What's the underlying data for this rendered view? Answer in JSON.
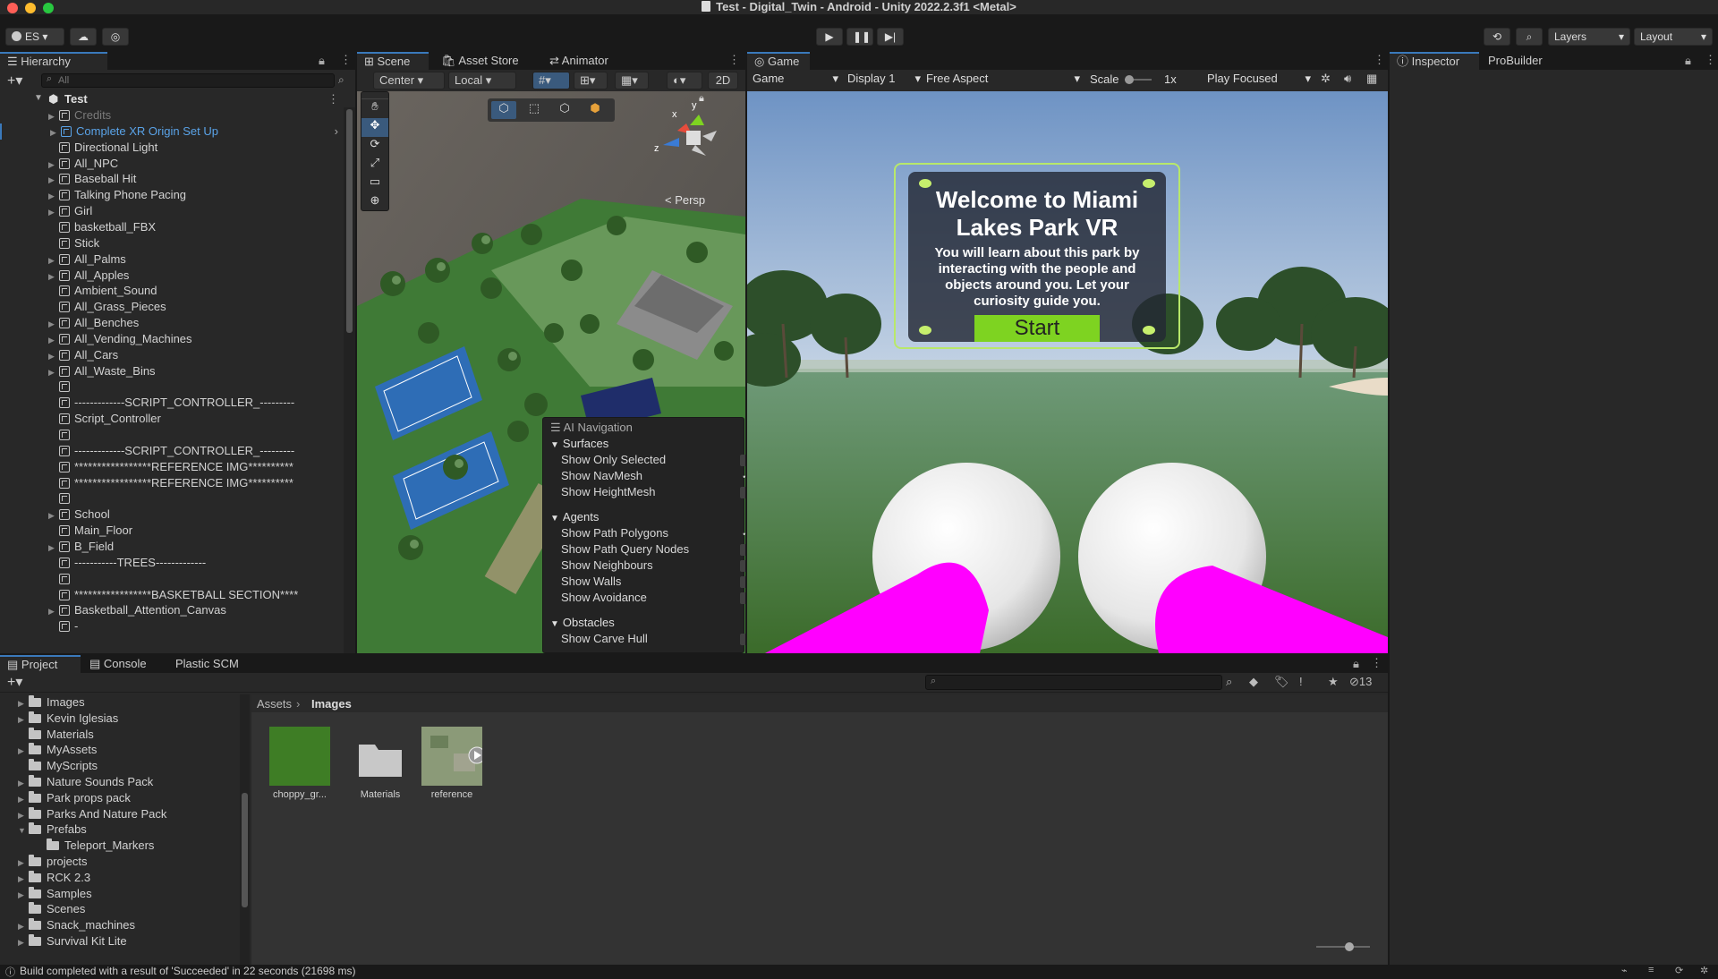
{
  "window": {
    "title": "Test - Digital_Twin - Android - Unity 2022.2.3f1 <Metal>"
  },
  "toolbar": {
    "account": "ES",
    "layers": "Layers",
    "layout": "Layout"
  },
  "hierarchy": {
    "tab": "Hierarchy",
    "search_placeholder": "All",
    "scene": "Test",
    "items": [
      {
        "label": "Credits",
        "arrow": "▶",
        "dim": true
      },
      {
        "label": "Complete XR Origin Set Up",
        "arrow": "▶",
        "blue": true
      },
      {
        "label": "Directional Light",
        "arrow": ""
      },
      {
        "label": "All_NPC",
        "arrow": "▶"
      },
      {
        "label": "Baseball Hit",
        "arrow": "▶"
      },
      {
        "label": "Talking Phone Pacing",
        "arrow": "▶"
      },
      {
        "label": "Girl",
        "arrow": "▶"
      },
      {
        "label": "basketball_FBX",
        "arrow": ""
      },
      {
        "label": "Stick",
        "arrow": ""
      },
      {
        "label": "All_Palms",
        "arrow": "▶"
      },
      {
        "label": "All_Apples",
        "arrow": "▶"
      },
      {
        "label": "Ambient_Sound",
        "arrow": ""
      },
      {
        "label": "All_Grass_Pieces",
        "arrow": ""
      },
      {
        "label": "All_Benches",
        "arrow": "▶"
      },
      {
        "label": "All_Vending_Machines",
        "arrow": "▶"
      },
      {
        "label": "All_Cars",
        "arrow": "▶"
      },
      {
        "label": "All_Waste_Bins",
        "arrow": "▶"
      },
      {
        "label": "",
        "arrow": ""
      },
      {
        "label": "-------------SCRIPT_CONTROLLER_---------",
        "arrow": ""
      },
      {
        "label": "Script_Controller",
        "arrow": ""
      },
      {
        "label": "",
        "arrow": ""
      },
      {
        "label": "-------------SCRIPT_CONTROLLER_---------",
        "arrow": ""
      },
      {
        "label": "*****************REFERENCE IMG**********",
        "arrow": ""
      },
      {
        "label": "*****************REFERENCE IMG**********",
        "arrow": ""
      },
      {
        "label": "",
        "arrow": ""
      },
      {
        "label": "School",
        "arrow": "▶"
      },
      {
        "label": "Main_Floor",
        "arrow": ""
      },
      {
        "label": "B_Field",
        "arrow": "▶"
      },
      {
        "label": "-----------TREES-------------",
        "arrow": ""
      },
      {
        "label": "",
        "arrow": ""
      },
      {
        "label": "*****************BASKETBALL SECTION****",
        "arrow": ""
      },
      {
        "label": "Basketball_Attention_Canvas",
        "arrow": "▶"
      },
      {
        "label": "-",
        "arrow": ""
      }
    ]
  },
  "scene": {
    "tabs": [
      "Scene",
      "Asset Store",
      "Animator"
    ],
    "pivot": "Center",
    "space": "Local",
    "mode2d": "2D",
    "persp": "< Persp",
    "gizmo": {
      "y": "y",
      "x": "x",
      "z": "z"
    },
    "ai_nav": {
      "title": "AI Navigation",
      "surfaces": "Surfaces",
      "surface_items": [
        {
          "label": "Show Only Selected",
          "checked": ""
        },
        {
          "label": "Show NavMesh",
          "checked": "✓"
        },
        {
          "label": "Show HeightMesh",
          "checked": ""
        }
      ],
      "agents": "Agents",
      "agent_items": [
        {
          "label": "Show Path Polygons",
          "checked": "✓"
        },
        {
          "label": "Show Path Query Nodes",
          "checked": ""
        },
        {
          "label": "Show Neighbours",
          "checked": ""
        },
        {
          "label": "Show Walls",
          "checked": ""
        },
        {
          "label": "Show Avoidance",
          "checked": ""
        }
      ],
      "obstacles": "Obstacles",
      "obstacle_items": [
        {
          "label": "Show Carve Hull",
          "checked": ""
        }
      ]
    }
  },
  "game": {
    "tab": "Game",
    "mode": "Game",
    "display": "Display 1",
    "aspect": "Free Aspect",
    "scale_label": "Scale",
    "scale_value": "1x",
    "play_mode": "Play Focused",
    "welcome_title": "Welcome to Miami Lakes Park VR",
    "welcome_body": "You will learn about this park by interacting with the people and objects around you. Let your curiosity guide you.",
    "start": "Start"
  },
  "inspector": {
    "tabs": [
      "Inspector",
      "ProBuilder"
    ]
  },
  "project": {
    "tabs": [
      "Project",
      "Console",
      "Plastic SCM"
    ],
    "hidden_count": "13",
    "tree": [
      {
        "label": "Images",
        "arrow": "▶",
        "indent": 0
      },
      {
        "label": "Kevin Iglesias",
        "arrow": "▶",
        "indent": 0
      },
      {
        "label": "Materials",
        "arrow": "",
        "indent": 0
      },
      {
        "label": "MyAssets",
        "arrow": "▶",
        "indent": 0
      },
      {
        "label": "MyScripts",
        "arrow": "",
        "indent": 0
      },
      {
        "label": "Nature Sounds Pack",
        "arrow": "▶",
        "indent": 0
      },
      {
        "label": "Park props pack",
        "arrow": "▶",
        "indent": 0
      },
      {
        "label": "Parks And Nature Pack",
        "arrow": "▶",
        "indent": 0
      },
      {
        "label": "Prefabs",
        "arrow": "▼",
        "indent": 0
      },
      {
        "label": "Teleport_Markers",
        "arrow": "",
        "indent": 1
      },
      {
        "label": "projects",
        "arrow": "▶",
        "indent": 0
      },
      {
        "label": "RCK 2.3",
        "arrow": "▶",
        "indent": 0
      },
      {
        "label": "Samples",
        "arrow": "▶",
        "indent": 0
      },
      {
        "label": "Scenes",
        "arrow": "",
        "indent": 0
      },
      {
        "label": "Snack_machines",
        "arrow": "▶",
        "indent": 0
      },
      {
        "label": "Survival Kit Lite",
        "arrow": "▶",
        "indent": 0
      }
    ],
    "breadcrumb_root": "Assets",
    "breadcrumb_current": "Images",
    "assets": [
      "choppy_gr...",
      "Materials",
      "reference"
    ]
  },
  "status": {
    "message": "Build completed with a result of 'Succeeded' in 22 seconds (21698 ms)"
  },
  "colors": {
    "accent": "#3a79bb",
    "selection": "#2c5d87",
    "start_green": "#7ed321",
    "hand_magenta": "#ff00ff"
  }
}
